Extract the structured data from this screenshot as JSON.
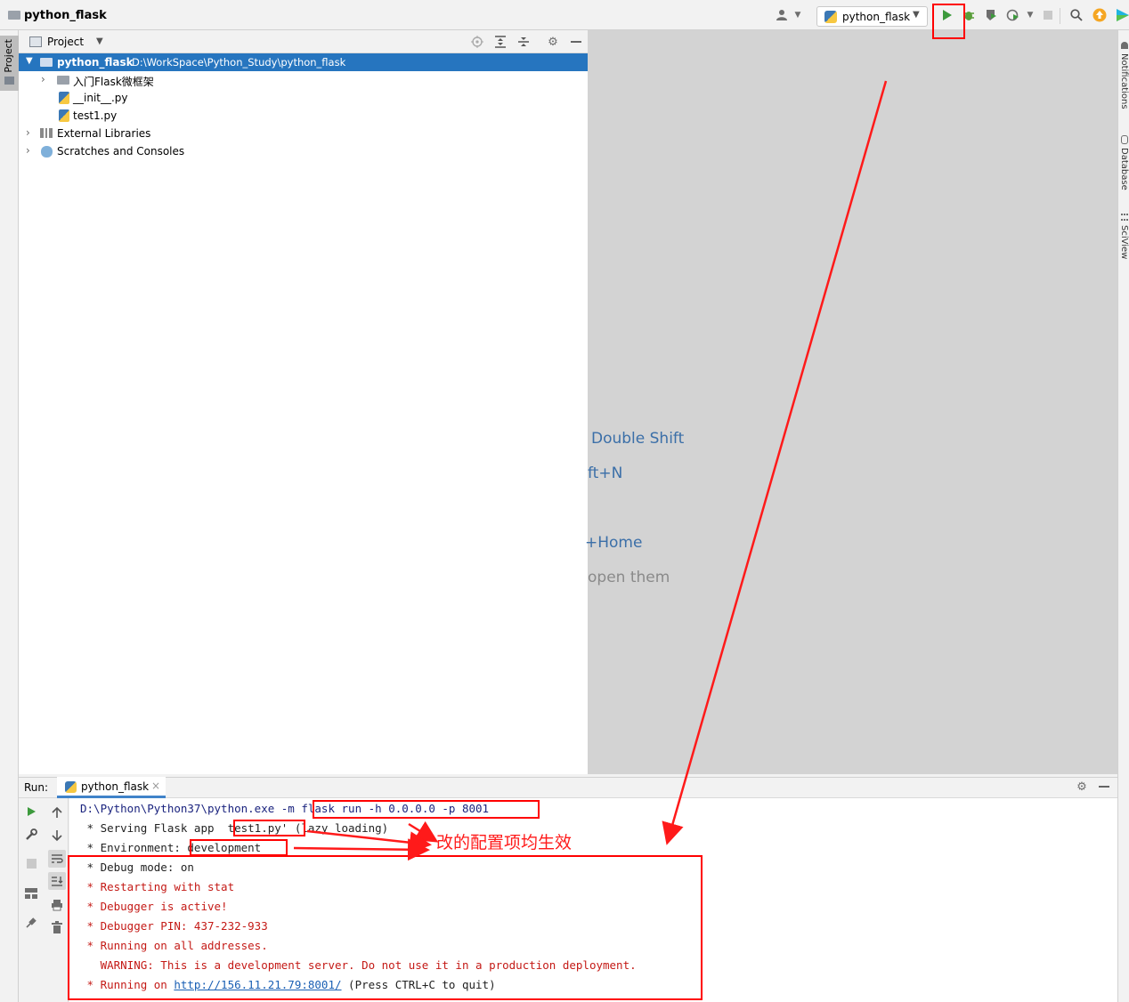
{
  "window": {
    "project_name": "python_flask"
  },
  "toolbar": {
    "run_config_label": "python_flask",
    "icons": [
      "user-icon",
      "python-icon",
      "run-icon",
      "debug-icon",
      "coverage-icon",
      "profile-icon",
      "stop-icon",
      "search-icon",
      "update-icon",
      "toolbox-icon"
    ]
  },
  "left_stripe": {
    "project_label": "Project"
  },
  "right_stripe": {
    "notifications_label": "Notifications",
    "database_label": "Database",
    "sciview_label": "SciView"
  },
  "project_panel": {
    "title": "Project",
    "tree": {
      "root_name": "python_flask",
      "root_path": "D:\\WorkSpace\\Python_Study\\python_flask",
      "folder_name": "入门Flask微框架",
      "file1": "__init__.py",
      "file2": "test1.py",
      "external_libraries": "External Libraries",
      "scratches": "Scratches and Consoles"
    }
  },
  "editor": {
    "hint_search": "Double Shift",
    "hint_goto_file": "ft+N",
    "hint_nav": "+Home",
    "hint_open": "open them"
  },
  "run_panel": {
    "label": "Run:",
    "tab_label": "python_flask",
    "console": {
      "line1_prefix": "D:\\Python\\Python37\\python.exe -m ",
      "line1_cmd": "flask run -h 0.0.0.0 -p 8001",
      "line2": " * Serving Flask app  test1.py' (lazy loading)",
      "line3": " * Environment: development",
      "line4": " * Debug mode: on",
      "line5": " * Restarting with stat",
      "line6": " * Debugger is active!",
      "line7": " * Debugger PIN: 437-232-933",
      "line8": " * Running on all addresses.",
      "line9": "   WARNING: This is a development server. Do not use it in a production deployment.",
      "line10_prefix": " * Running on ",
      "line10_url": "http://156.11.21.79:8001/",
      "line10_suffix": " (Press CTRL+C to quit)"
    }
  },
  "annotation": {
    "text": "改的配置项均生效",
    "color": "#ff0000"
  }
}
